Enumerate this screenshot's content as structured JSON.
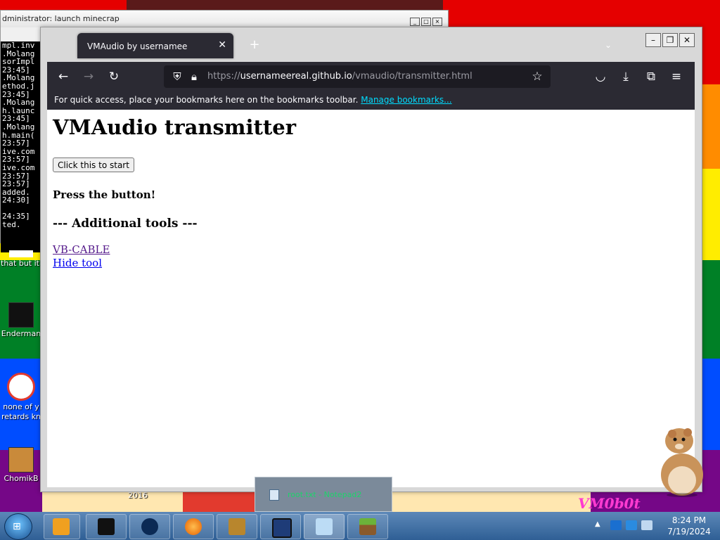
{
  "desktop": {
    "cmd_window": {
      "title": "dministrator:  launch minecrap",
      "lines": [
        "mpl.inv",
        ".Molang",
        "sorImpl",
        "23:45]",
        ".Molang",
        "ethod.j",
        "23:45]",
        ".Molang",
        "h.launc",
        "23:45]",
        ".Molang",
        "h.main(",
        "23:57]",
        "ive.com",
        "23:57]",
        "ive.com",
        "23:57]",
        "23:57]",
        "added.",
        "24:30]",
        "",
        "24:35]",
        "ted."
      ]
    },
    "icons": [
      {
        "label": "that but it'"
      },
      {
        "label": "Enderman"
      },
      {
        "label": "none of y retards kn"
      },
      {
        "label": "ChomikB"
      }
    ],
    "year_label": "2016",
    "vm_logo": "VM0b0t"
  },
  "browser": {
    "tab_title": "VMAudio by usernamee",
    "url_host": "usernameereal.github.io",
    "url_scheme": "https://",
    "url_path": "/vmaudio/transmitter.html",
    "bookmarks_text": "For quick access, place your bookmarks here on the bookmarks toolbar.",
    "bookmarks_link": "Manage bookmarks..."
  },
  "page": {
    "heading": "VMAudio transmitter",
    "start_button": "Click this to start",
    "status": "Press the button!",
    "tools_heading": "--- Additional tools ---",
    "links": [
      "VB-CABLE",
      "Hide tool"
    ]
  },
  "popup": {
    "text": "root.txt - Notepad2"
  },
  "taskbar": {
    "time": "8:24 PM",
    "date": "7/19/2024"
  }
}
